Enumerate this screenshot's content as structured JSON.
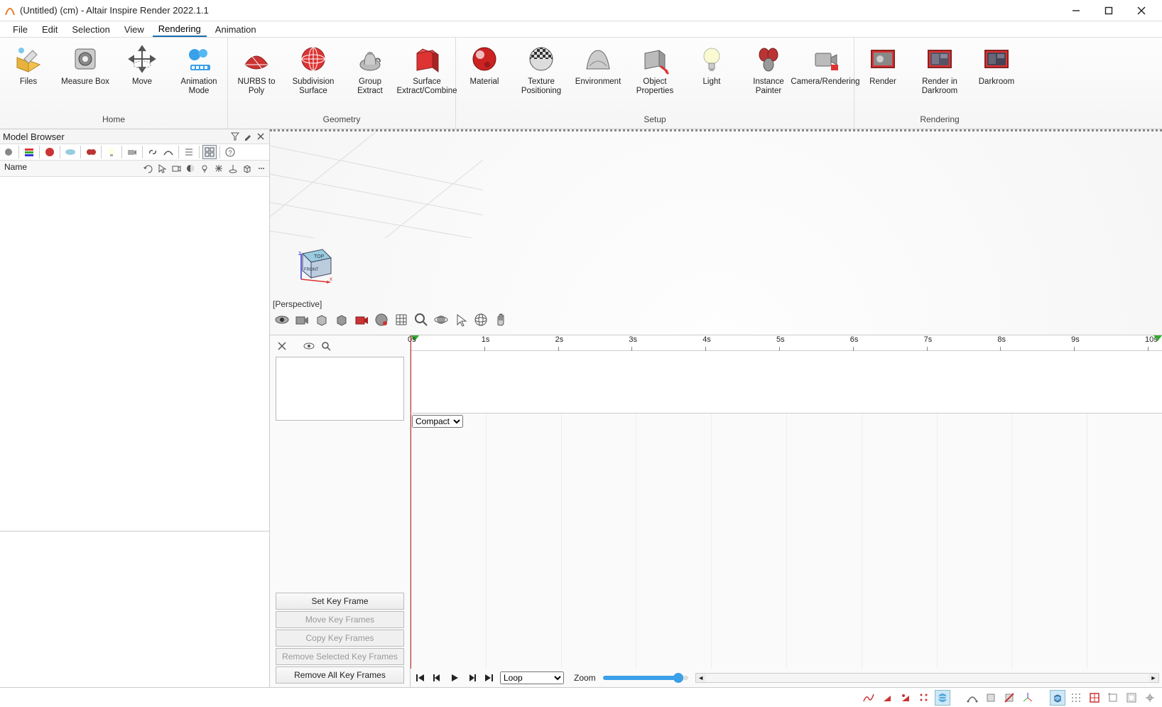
{
  "window": {
    "title": "(Untitled) (cm) - Altair Inspire Render 2022.1.1"
  },
  "menu": {
    "file": "File",
    "edit": "Edit",
    "selection": "Selection",
    "view": "View",
    "rendering": "Rendering",
    "animation": "Animation"
  },
  "ribbon": {
    "home": {
      "label": "Home",
      "files": "Files",
      "measure": "Measure Box",
      "move": "Move",
      "animmode": "Animation Mode"
    },
    "geometry": {
      "label": "Geometry",
      "nurbs": "NURBS to Poly",
      "subdiv": "Subdivision Surface",
      "group": "Group Extract",
      "surface": "Surface Extract/Combine"
    },
    "setup": {
      "label": "Setup",
      "material": "Material",
      "texture": "Texture Positioning",
      "env": "Environment",
      "objprops": "Object Properties",
      "light": "Light",
      "instpaint": "Instance Painter",
      "camrender": "Camera/Rendering"
    },
    "rendering": {
      "label": "Rendering",
      "render": "Render",
      "darkroomrender": "Render in Darkroom",
      "darkroom": "Darkroom"
    }
  },
  "browser": {
    "title": "Model Browser",
    "name_col": "Name"
  },
  "viewport": {
    "perspective": "[Perspective]",
    "cube_top": "TOP",
    "cube_front": "FRONT"
  },
  "timeline": {
    "ticks": [
      "0s",
      "1s",
      "2s",
      "3s",
      "4s",
      "5s",
      "6s",
      "7s",
      "8s",
      "9s",
      "10s"
    ],
    "compact": "Compact"
  },
  "keyframes": {
    "set": "Set Key Frame",
    "move": "Move Key Frames",
    "copy": "Copy Key Frames",
    "removesel": "Remove Selected Key Frames",
    "removeall": "Remove All Key Frames"
  },
  "playback": {
    "mode": "Loop",
    "zoom": "Zoom"
  }
}
